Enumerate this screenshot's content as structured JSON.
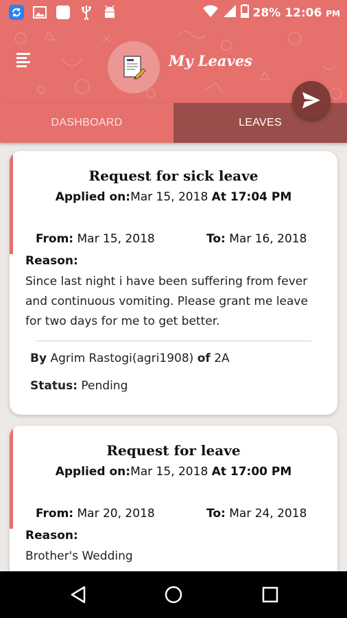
{
  "status_bar": {
    "battery": "28%",
    "time": "12:06",
    "ampm": "PM",
    "icons": [
      "sync-icon",
      "image-icon",
      "square-notification-icon",
      "usb-icon",
      "android-icon",
      "wifi-icon",
      "signal-icon",
      "battery-icon"
    ]
  },
  "toolbar": {
    "title": "My Leaves",
    "app_icon": "leave-form-icon",
    "menu_icon": "menu-icon",
    "fab_icon": "send-icon"
  },
  "tabs": [
    {
      "label": "DASHBOARD",
      "selected": false
    },
    {
      "label": "LEAVES",
      "selected": true
    }
  ],
  "leaves": [
    {
      "title": "Request for sick leave",
      "applied_label": "Applied on:",
      "applied_date": "Mar 15, 2018",
      "applied_at": "At 17:04 PM",
      "from_label": "From:",
      "from_date": "Mar 15, 2018",
      "to_label": "To:",
      "to_date": "Mar 16, 2018",
      "reason_label": "Reason:",
      "reason_lines": [
        "Since last night i have been suffering from fever",
        "and continuous vomiting. Please grant me leave",
        "for two days for me to get better."
      ],
      "by_label": "By",
      "by_name": "Agrim Rastogi(agri1908)",
      "of_label": "of",
      "class_name": "2A",
      "status_label": "Status:",
      "status_value": "Pending"
    },
    {
      "title": "Request for leave",
      "applied_label": "Applied on:",
      "applied_date": "Mar 15, 2018",
      "applied_at": "At 17:00 PM",
      "from_label": "From:",
      "from_date": "Mar 20, 2018",
      "to_label": "To:",
      "to_date": "Mar 24, 2018",
      "reason_label": "Reason:",
      "reason_lines": [
        "Brother's Wedding"
      ]
    }
  ],
  "nav": {
    "back": "back-icon",
    "home": "home-icon",
    "recents": "recents-icon"
  },
  "colors": {
    "primary": "#e5706c",
    "tab_selected": "#9a4e4b",
    "fab": "#7e3b38",
    "background": "#ece9e7"
  }
}
